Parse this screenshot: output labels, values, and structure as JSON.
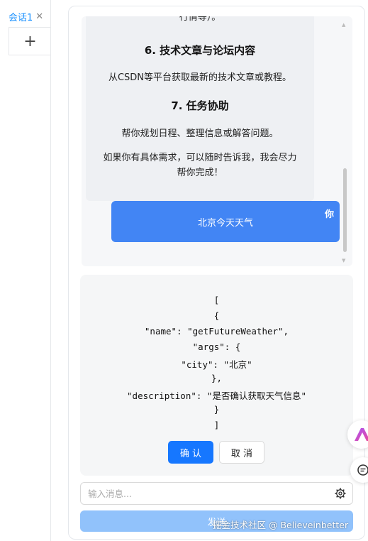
{
  "tabs": {
    "active_label": "会话1",
    "close_glyph": "✕",
    "add_glyph": "+"
  },
  "history": {
    "assistant_lines": {
      "cut_top": "行情等）。",
      "h6": "6. 技术文章与论坛内容",
      "p6": "从CSDN等平台获取最新的技术文章或教程。",
      "h7": "7. 任务协助",
      "p7": "帮你规划日程、整理信息或解答问题。",
      "closing_1": "如果你有具体需求，可以随时告诉我，我会尽力",
      "closing_2": "帮你完成！"
    },
    "user_message": {
      "sender": "你",
      "text": "北京今天天气"
    }
  },
  "function_call": {
    "lines": [
      "[",
      "{",
      "\"name\": \"getFutureWeather\",",
      "\"args\": {",
      "\"city\": \"北京\"",
      "},",
      "\"description\": \"是否确认获取天气信息\"",
      "}",
      "]"
    ],
    "confirm_label": "确 认",
    "cancel_label": "取 消"
  },
  "composer": {
    "placeholder": "输入消息...",
    "send_label": "发送"
  },
  "watermark": "掘金技术社区 @ Believeinbetter",
  "colors": {
    "accent": "#1677ff",
    "user_bubble": "#4285f4",
    "send_disabled": "#91c2fb"
  },
  "icons": [
    "close-icon",
    "plus-icon",
    "settings-icon",
    "scroll-up-icon",
    "scroll-down-icon",
    "ai-assistant-icon",
    "chat-icon"
  ]
}
